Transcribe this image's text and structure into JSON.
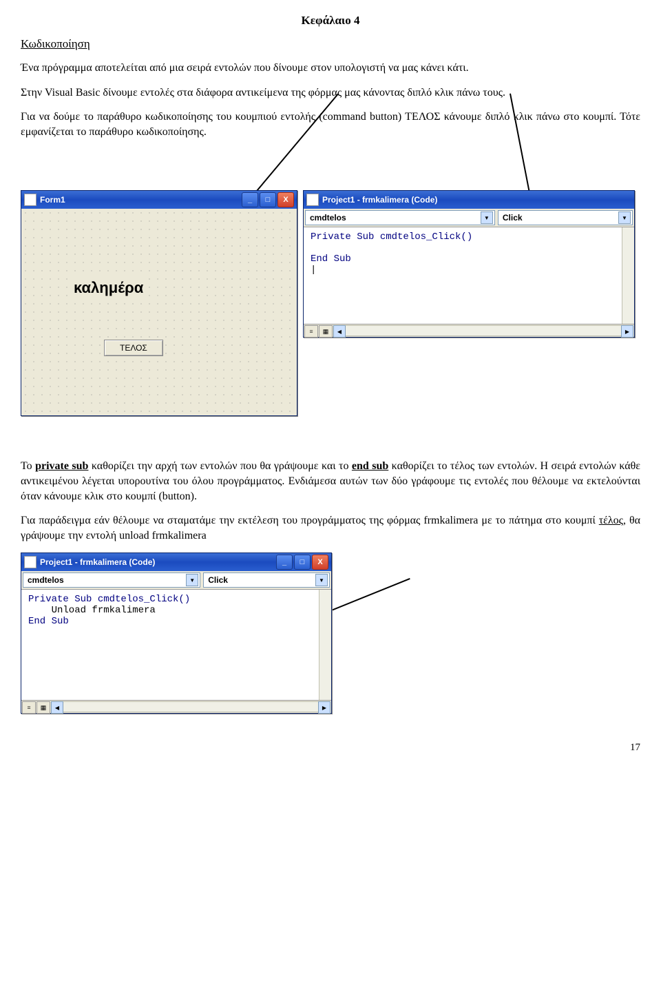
{
  "chapter_title": "Κεφάλαιο 4",
  "section_title": "Κωδικοποίηση",
  "para1": "Ένα πρόγραμμα αποτελείται από μια σειρά εντολών που δίνουμε στον υπολογιστή να μας κάνει κάτι.",
  "para2": "Στην Visual Basic δίνουμε εντολές στα διάφορα αντικείμενα της φόρμας μας κάνοντας διπλό κλικ πάνω τους.",
  "para3": "Για να δούμε το παράθυρο κωδικοποίησης του κουμπιού εντολής (command button) ΤΕΛΟΣ κάνουμε διπλό κλικ πάνω στο κουμπί. Τότε εμφανίζεται το παράθυρο κωδικοποίησης.",
  "para4_a": "Το ",
  "para4_b": "private sub",
  "para4_c": " καθορίζει την αρχή των εντολών που θα γράψουμε και το ",
  "para4_d": "end sub",
  "para4_e": " καθορίζει το τέλος των εντολών. Η σειρά εντολών κάθε αντικειμένου λέγεται υπορουτίνα του όλου προγράμματος. Ενδιάμεσα αυτών των δύο γράφουμε τις εντολές που θέλουμε να εκτελούνται όταν κάνουμε κλικ στο κουμπί (button).",
  "para5_a": "Για παράδειγμα εάν θέλουμε να σταματάμε την εκτέλεση του προγράμματος της φόρμας frmkalimera με το πάτημα στο κουμπί ",
  "para5_b": "τέλος",
  "para5_c": ", θα γράψουμε την εντολή unload frmkalimera",
  "form1": {
    "title": "Form1",
    "label": "καλημέρα",
    "button": "ΤΕΛΟΣ"
  },
  "codewin1": {
    "title": "Project1 - frmkalimera (Code)",
    "combo_left": "cmdtelos",
    "combo_right": "Click",
    "line1": "Private Sub cmdtelos_Click()",
    "line2": "",
    "line3": "End Sub",
    "line4": "|"
  },
  "codewin2": {
    "title": "Project1 - frmkalimera (Code)",
    "combo_left": "cmdtelos",
    "combo_right": "Click",
    "line1": "Private Sub cmdtelos_Click()",
    "line2": "    Unload frmkalimera",
    "line3": "End Sub"
  },
  "tb": {
    "min": "_",
    "max": "□",
    "close": "X"
  },
  "page_number": "17"
}
